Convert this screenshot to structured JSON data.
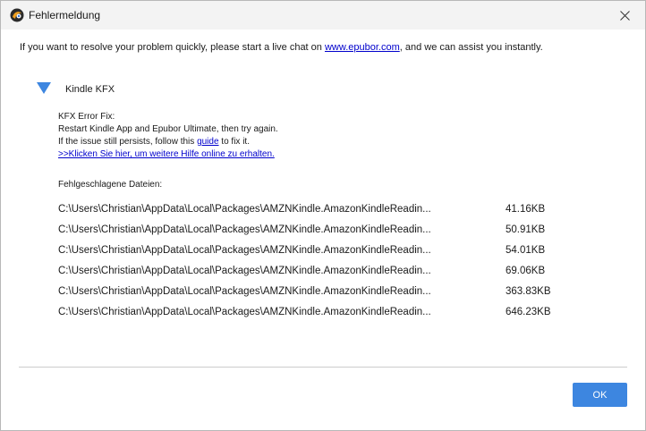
{
  "window": {
    "title": "Fehlermeldung"
  },
  "intro": {
    "before": "If you want to resolve your problem quickly, please start a live chat on ",
    "link": "www.epubor.com",
    "after": ", and we can assist you instantly."
  },
  "section": {
    "title": "Kindle KFX",
    "fix_heading": "KFX Error Fix:",
    "fix_line1": "Restart Kindle App and Epubor Ultimate, then try again.",
    "fix_line2_before": "If the issue still persists, follow this ",
    "fix_line2_link": "guide",
    "fix_line2_after": " to fix it.",
    "help_link": ">>Klicken Sie hier, um weitere Hilfe online zu erhalten."
  },
  "failed_files": {
    "label": "Fehlgeschlagene Dateien:",
    "rows": [
      {
        "path": "C:\\Users\\Christian\\AppData\\Local\\Packages\\AMZNKindle.AmazonKindleReadin...",
        "size": "41.16KB"
      },
      {
        "path": "C:\\Users\\Christian\\AppData\\Local\\Packages\\AMZNKindle.AmazonKindleReadin...",
        "size": "50.91KB"
      },
      {
        "path": "C:\\Users\\Christian\\AppData\\Local\\Packages\\AMZNKindle.AmazonKindleReadin...",
        "size": "54.01KB"
      },
      {
        "path": "C:\\Users\\Christian\\AppData\\Local\\Packages\\AMZNKindle.AmazonKindleReadin...",
        "size": "69.06KB"
      },
      {
        "path": "C:\\Users\\Christian\\AppData\\Local\\Packages\\AMZNKindle.AmazonKindleReadin...",
        "size": "363.83KB"
      },
      {
        "path": "C:\\Users\\Christian\\AppData\\Local\\Packages\\AMZNKindle.AmazonKindleReadin...",
        "size": "646.23KB"
      }
    ]
  },
  "buttons": {
    "ok": "OK"
  },
  "icons": {
    "app": "epubor-app-icon",
    "close": "close-icon",
    "expand": "expand-triangle-icon"
  },
  "colors": {
    "accent": "#3d86e0",
    "link": "#0000cc",
    "titlebar": "#f3f3f3"
  }
}
